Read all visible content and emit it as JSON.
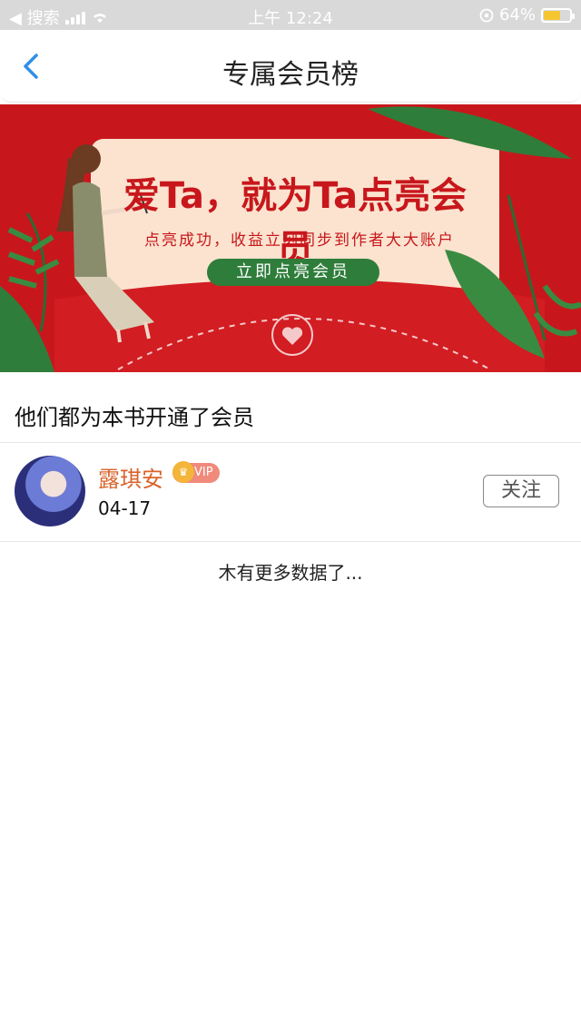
{
  "status_bar": {
    "back_label": "◀ 搜索",
    "time": "上午 12:24",
    "battery": "64%",
    "battery_level": 0.64
  },
  "nav": {
    "title": "专属会员榜"
  },
  "banner": {
    "headline": "爱Ta，就为Ta点亮会员",
    "subtitle": "点亮成功，收益立刻同步到作者大大账户",
    "cta": "立即点亮会员"
  },
  "section": {
    "title": "他们都为本书开通了会员"
  },
  "members": [
    {
      "name": "露琪安",
      "badge": "VIP",
      "date": "04-17",
      "follow_label": "关注"
    }
  ],
  "footer": {
    "no_more": "木有更多数据了..."
  },
  "colors": {
    "accent_blue": "#2f8fe8",
    "banner_red": "#c8171c",
    "cta_green": "#2e7d3a",
    "name_orange": "#d9622b"
  }
}
